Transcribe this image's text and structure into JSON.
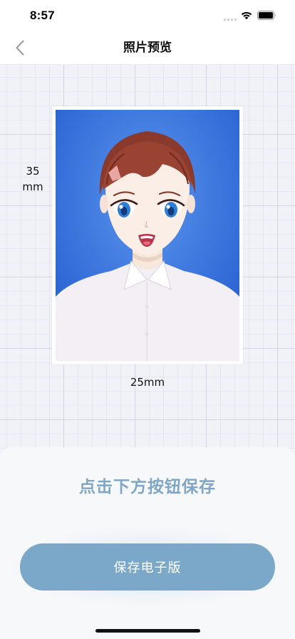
{
  "status_bar": {
    "time": "8:57"
  },
  "nav": {
    "title": "照片预览",
    "back_icon": "chevron-left-icon"
  },
  "preview": {
    "height_value": "35",
    "height_unit": "mm",
    "width_label": "25mm",
    "photo_background_color": "#3f7fe3"
  },
  "bottom_sheet": {
    "hint": "点击下方按钮保存",
    "save_button_label": "保存电子版"
  },
  "colors": {
    "accent": "#7ba8c9",
    "hint_text": "#7fa6c5"
  }
}
